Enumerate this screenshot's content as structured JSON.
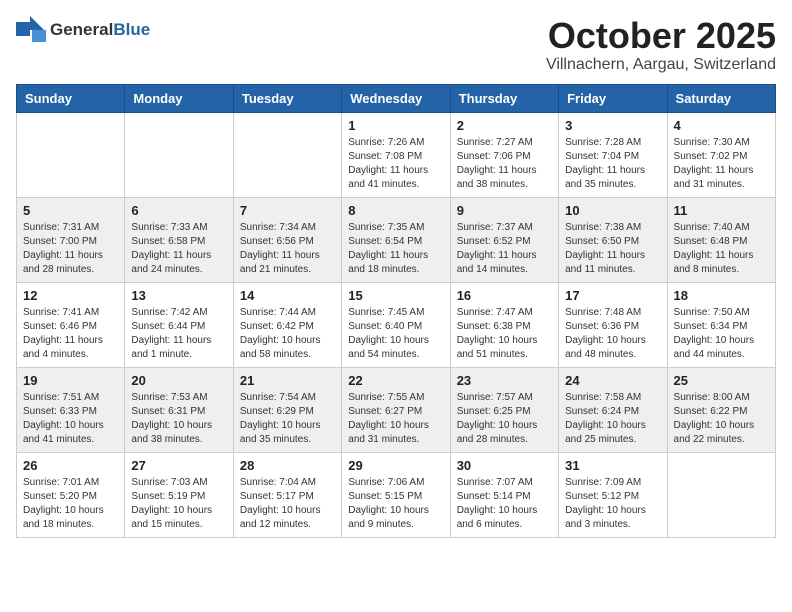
{
  "header": {
    "logo_general": "General",
    "logo_blue": "Blue",
    "month_title": "October 2025",
    "location": "Villnachern, Aargau, Switzerland"
  },
  "weekdays": [
    "Sunday",
    "Monday",
    "Tuesday",
    "Wednesday",
    "Thursday",
    "Friday",
    "Saturday"
  ],
  "weeks": [
    [
      {
        "day": "",
        "info": ""
      },
      {
        "day": "",
        "info": ""
      },
      {
        "day": "",
        "info": ""
      },
      {
        "day": "1",
        "info": "Sunrise: 7:26 AM\nSunset: 7:08 PM\nDaylight: 11 hours and 41 minutes."
      },
      {
        "day": "2",
        "info": "Sunrise: 7:27 AM\nSunset: 7:06 PM\nDaylight: 11 hours and 38 minutes."
      },
      {
        "day": "3",
        "info": "Sunrise: 7:28 AM\nSunset: 7:04 PM\nDaylight: 11 hours and 35 minutes."
      },
      {
        "day": "4",
        "info": "Sunrise: 7:30 AM\nSunset: 7:02 PM\nDaylight: 11 hours and 31 minutes."
      }
    ],
    [
      {
        "day": "5",
        "info": "Sunrise: 7:31 AM\nSunset: 7:00 PM\nDaylight: 11 hours and 28 minutes."
      },
      {
        "day": "6",
        "info": "Sunrise: 7:33 AM\nSunset: 6:58 PM\nDaylight: 11 hours and 24 minutes."
      },
      {
        "day": "7",
        "info": "Sunrise: 7:34 AM\nSunset: 6:56 PM\nDaylight: 11 hours and 21 minutes."
      },
      {
        "day": "8",
        "info": "Sunrise: 7:35 AM\nSunset: 6:54 PM\nDaylight: 11 hours and 18 minutes."
      },
      {
        "day": "9",
        "info": "Sunrise: 7:37 AM\nSunset: 6:52 PM\nDaylight: 11 hours and 14 minutes."
      },
      {
        "day": "10",
        "info": "Sunrise: 7:38 AM\nSunset: 6:50 PM\nDaylight: 11 hours and 11 minutes."
      },
      {
        "day": "11",
        "info": "Sunrise: 7:40 AM\nSunset: 6:48 PM\nDaylight: 11 hours and 8 minutes."
      }
    ],
    [
      {
        "day": "12",
        "info": "Sunrise: 7:41 AM\nSunset: 6:46 PM\nDaylight: 11 hours and 4 minutes."
      },
      {
        "day": "13",
        "info": "Sunrise: 7:42 AM\nSunset: 6:44 PM\nDaylight: 11 hours and 1 minute."
      },
      {
        "day": "14",
        "info": "Sunrise: 7:44 AM\nSunset: 6:42 PM\nDaylight: 10 hours and 58 minutes."
      },
      {
        "day": "15",
        "info": "Sunrise: 7:45 AM\nSunset: 6:40 PM\nDaylight: 10 hours and 54 minutes."
      },
      {
        "day": "16",
        "info": "Sunrise: 7:47 AM\nSunset: 6:38 PM\nDaylight: 10 hours and 51 minutes."
      },
      {
        "day": "17",
        "info": "Sunrise: 7:48 AM\nSunset: 6:36 PM\nDaylight: 10 hours and 48 minutes."
      },
      {
        "day": "18",
        "info": "Sunrise: 7:50 AM\nSunset: 6:34 PM\nDaylight: 10 hours and 44 minutes."
      }
    ],
    [
      {
        "day": "19",
        "info": "Sunrise: 7:51 AM\nSunset: 6:33 PM\nDaylight: 10 hours and 41 minutes."
      },
      {
        "day": "20",
        "info": "Sunrise: 7:53 AM\nSunset: 6:31 PM\nDaylight: 10 hours and 38 minutes."
      },
      {
        "day": "21",
        "info": "Sunrise: 7:54 AM\nSunset: 6:29 PM\nDaylight: 10 hours and 35 minutes."
      },
      {
        "day": "22",
        "info": "Sunrise: 7:55 AM\nSunset: 6:27 PM\nDaylight: 10 hours and 31 minutes."
      },
      {
        "day": "23",
        "info": "Sunrise: 7:57 AM\nSunset: 6:25 PM\nDaylight: 10 hours and 28 minutes."
      },
      {
        "day": "24",
        "info": "Sunrise: 7:58 AM\nSunset: 6:24 PM\nDaylight: 10 hours and 25 minutes."
      },
      {
        "day": "25",
        "info": "Sunrise: 8:00 AM\nSunset: 6:22 PM\nDaylight: 10 hours and 22 minutes."
      }
    ],
    [
      {
        "day": "26",
        "info": "Sunrise: 7:01 AM\nSunset: 5:20 PM\nDaylight: 10 hours and 18 minutes."
      },
      {
        "day": "27",
        "info": "Sunrise: 7:03 AM\nSunset: 5:19 PM\nDaylight: 10 hours and 15 minutes."
      },
      {
        "day": "28",
        "info": "Sunrise: 7:04 AM\nSunset: 5:17 PM\nDaylight: 10 hours and 12 minutes."
      },
      {
        "day": "29",
        "info": "Sunrise: 7:06 AM\nSunset: 5:15 PM\nDaylight: 10 hours and 9 minutes."
      },
      {
        "day": "30",
        "info": "Sunrise: 7:07 AM\nSunset: 5:14 PM\nDaylight: 10 hours and 6 minutes."
      },
      {
        "day": "31",
        "info": "Sunrise: 7:09 AM\nSunset: 5:12 PM\nDaylight: 10 hours and 3 minutes."
      },
      {
        "day": "",
        "info": ""
      }
    ]
  ]
}
